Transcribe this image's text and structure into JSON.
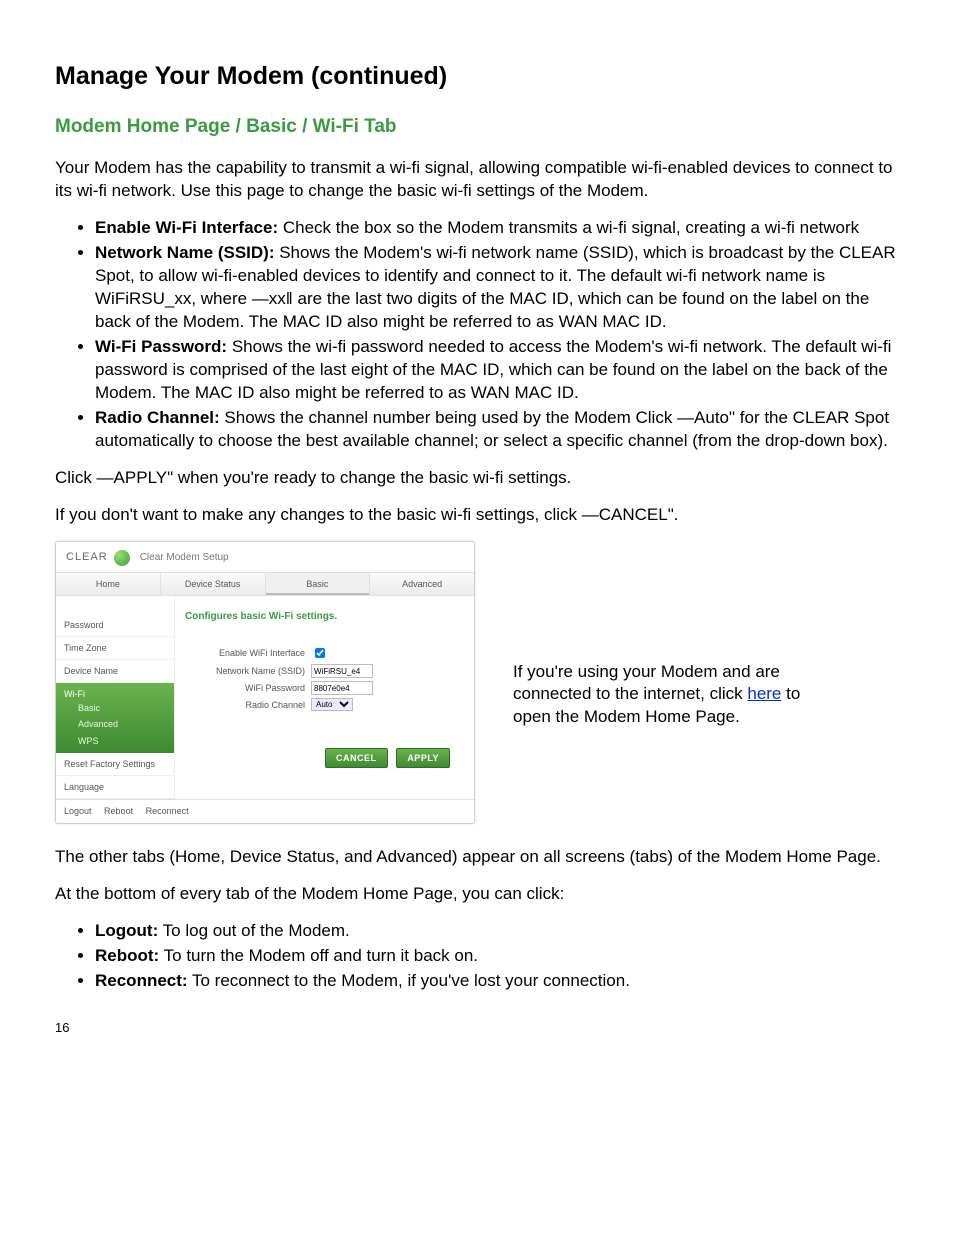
{
  "title": "Manage Your Modem (continued)",
  "subtitle": "Modem Home Page / Basic / Wi-Fi Tab",
  "intro": "Your Modem has the capability to transmit a wi-fi signal, allowing compatible wi-fi-enabled devices to connect to its wi-fi network.   Use this page to change the basic wi-fi settings of the Modem.",
  "bullets1": [
    {
      "b": "Enable Wi-Fi Interface:",
      "t": "  Check the box so the Modem transmits a wi-fi signal, creating a wi-fi network"
    },
    {
      "b": "Network Name (SSID):",
      "t": "   Shows the Modem's wi-fi network name (SSID), which is broadcast by the CLEAR Spot, to allow wi-fi-enabled devices to identify and connect to it.  The default wi-fi network name is WiFiRSU_xx, where ―xx‖ are the last two digits of the MAC ID, which can be found on the label on the back of the Modem.  The MAC ID also might be referred to as WAN MAC ID."
    },
    {
      "b": "Wi-Fi Password:",
      "t": "  Shows the wi-fi password needed to access the Modem's wi-fi network.  The default wi-fi password is comprised of the last eight of the MAC ID, which can be found on the label on the back of the Modem.   The MAC ID also might be referred to as WAN MAC ID."
    },
    {
      "b": "Radio Channel:",
      "t": " Shows the channel number being used by the Modem Click ―Auto\" for the CLEAR Spot automatically to choose the best available channel; or select a specific channel (from the drop-down box)."
    }
  ],
  "apply_line": "Click ―APPLY\" when you're ready to change the basic wi-fi settings.",
  "cancel_line": "If you don't want to make any changes to the basic wi-fi settings, click ―CANCEL\".",
  "shot": {
    "brand": "CLEAR",
    "brand_sub": "Clear Modem Setup",
    "tabs": [
      "Home",
      "Device Status",
      "Basic",
      "Advanced"
    ],
    "active_tab": 2,
    "sidebar": {
      "items_top": [
        "Password",
        "Time Zone",
        "Device Name"
      ],
      "active": "Wi-Fi",
      "subs": [
        "Basic",
        "Advanced",
        "WPS"
      ],
      "items_bottom": [
        "Reset Factory Settings",
        "Language"
      ]
    },
    "main": {
      "heading": "Configures basic Wi-Fi settings.",
      "fields": {
        "enable_label": "Enable WiFi Interface",
        "ssid_label": "Network Name (SSID)",
        "ssid_value": "WiFiRSU_e4",
        "pw_label": "WiFi Password",
        "pw_value": "8807e0e4",
        "radio_label": "Radio Channel",
        "radio_value": "Auto"
      },
      "buttons": {
        "cancel": "CANCEL",
        "apply": "APPLY"
      }
    },
    "footer": [
      "Logout",
      "Reboot",
      "Reconnect"
    ]
  },
  "side_note_pre": "If you're using your Modem and are connected to the internet, click ",
  "side_note_link": "here",
  "side_note_post": " to open the Modem Home Page.",
  "other_tabs": " The other tabs (Home, Device Status, and Advanced) appear on all screens (tabs) of the Modem Home Page.",
  "bottom_intro": "At the bottom of every tab of the Modem Home Page, you can click:",
  "bullets2": [
    {
      "b": "Logout:",
      "t": " To log out of the Modem."
    },
    {
      "b": "Reboot:",
      "t": " To turn the Modem off and turn it back on."
    },
    {
      "b": "Reconnect:",
      "t": " To reconnect to the Modem, if you've lost your connection."
    }
  ],
  "page_num": "16"
}
